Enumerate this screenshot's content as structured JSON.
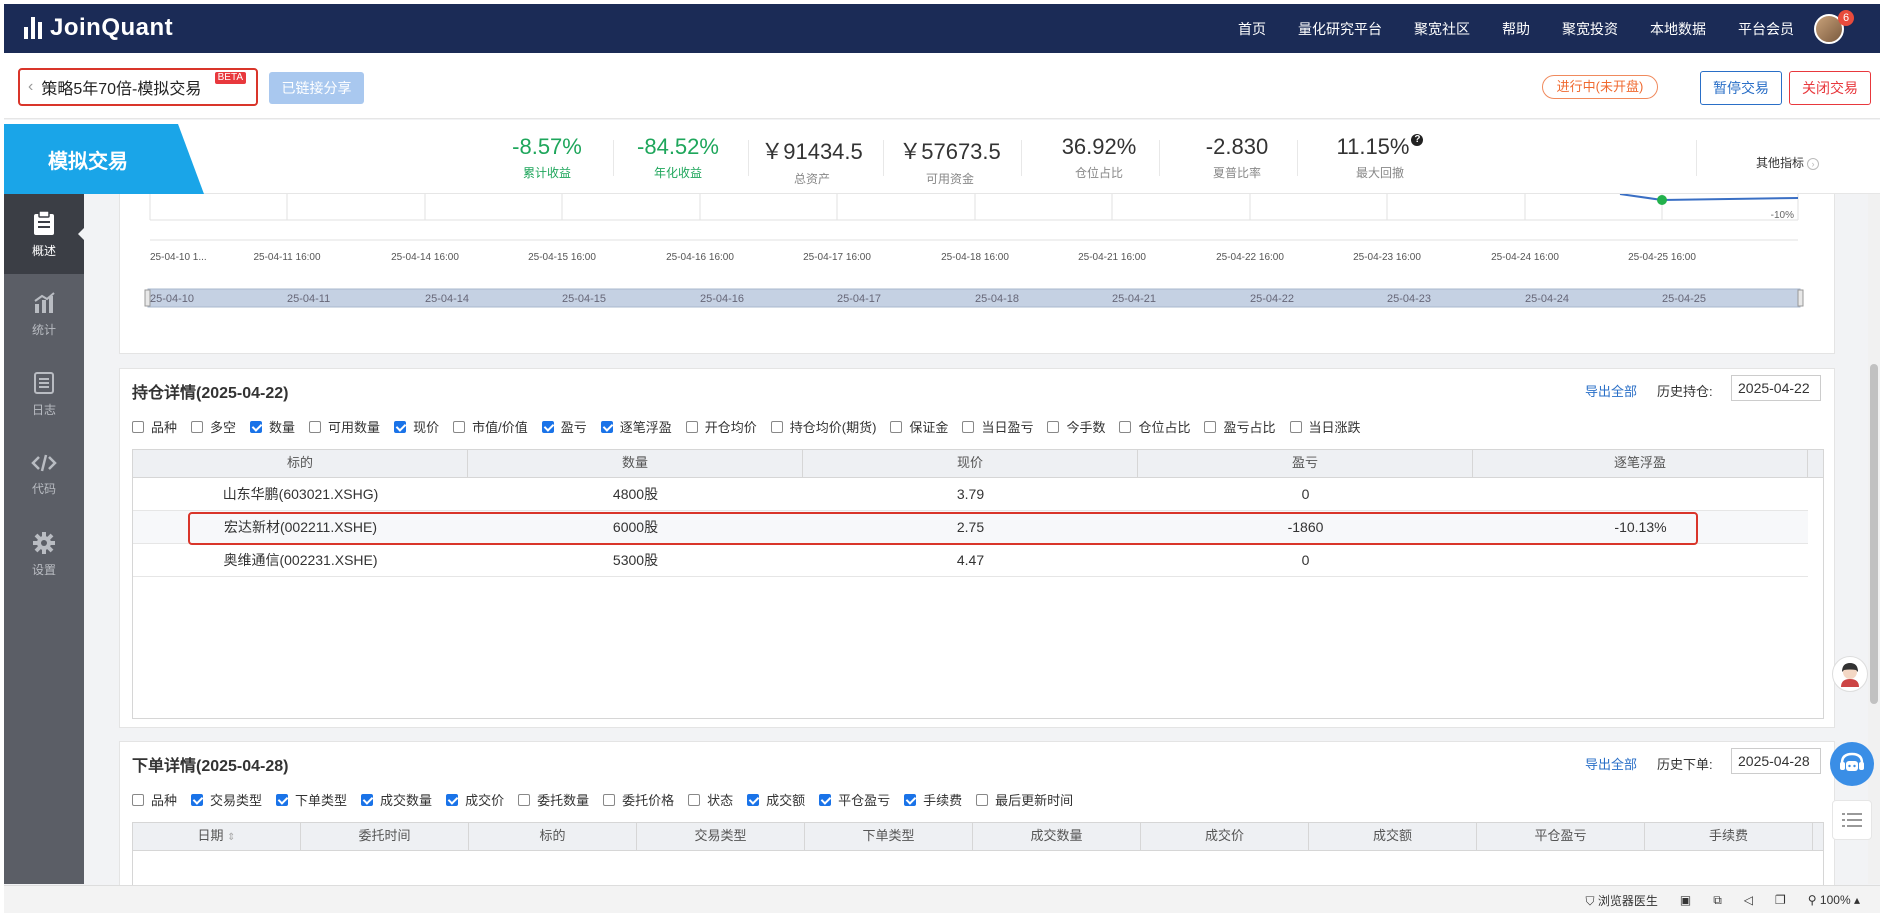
{
  "app": {
    "logo_text": "JoinQuant"
  },
  "nav": {
    "links": [
      "首页",
      "量化研究平台",
      "聚宽社区",
      "帮助",
      "聚宽投资",
      "本地数据",
      "平台会员"
    ],
    "avatar_badge": "6"
  },
  "title_bar": {
    "strategy_name": "策略5年70倍-模拟交易",
    "beta_label": "BETA",
    "share_button": "已链接分享",
    "status": "进行中(未开盘)",
    "pause_button": "暂停交易",
    "close_button": "关闭交易"
  },
  "metrics_bar": {
    "mode_label": "模拟交易",
    "metrics": [
      {
        "value": "-8.57%",
        "label": "累计收益",
        "color": "#1ea65b"
      },
      {
        "value": "-84.52%",
        "label": "年化收益",
        "color": "#1ea65b"
      },
      {
        "value": "￥91434.5",
        "label": "总资产"
      },
      {
        "value": "￥57673.5",
        "label": "可用资金"
      },
      {
        "value": "36.92%",
        "label": "仓位占比"
      },
      {
        "value": "-2.830",
        "label": "夏普比率"
      },
      {
        "value": "11.15%",
        "label": "最大回撤"
      }
    ],
    "other_metrics": "其他指标"
  },
  "sidebar": {
    "items": [
      {
        "label": "概述",
        "icon": "clipboard-icon",
        "active": true
      },
      {
        "label": "统计",
        "icon": "stats-icon"
      },
      {
        "label": "日志",
        "icon": "log-icon"
      },
      {
        "label": "代码",
        "icon": "code-icon"
      },
      {
        "label": "设置",
        "icon": "gear-icon"
      }
    ]
  },
  "chart": {
    "y_label": "-10%",
    "x_ticks": [
      "25-04-10 1...",
      "25-04-11 16:00",
      "25-04-14 16:00",
      "25-04-15 16:00",
      "25-04-16 16:00",
      "25-04-17 16:00",
      "25-04-18 16:00",
      "25-04-21 16:00",
      "25-04-22 16:00",
      "25-04-23 16:00",
      "25-04-24 16:00",
      "25-04-25 16:00"
    ],
    "range_ticks": [
      "25-04-10",
      "25-04-11",
      "25-04-14",
      "25-04-15",
      "25-04-16",
      "25-04-17",
      "25-04-18",
      "25-04-21",
      "25-04-22",
      "25-04-23",
      "25-04-24",
      "25-04-25"
    ]
  },
  "positions": {
    "title": "持仓详情(2025-04-22)",
    "export_label": "导出全部",
    "history_label": "历史持仓:",
    "date_value": "2025-04-22",
    "checkboxes": [
      {
        "label": "品种",
        "checked": false
      },
      {
        "label": "多空",
        "checked": false
      },
      {
        "label": "数量",
        "checked": true
      },
      {
        "label": "可用数量",
        "checked": false
      },
      {
        "label": "现价",
        "checked": true
      },
      {
        "label": "市值/价值",
        "checked": false
      },
      {
        "label": "盈亏",
        "checked": true
      },
      {
        "label": "逐笔浮盈",
        "checked": true
      },
      {
        "label": "开仓均价",
        "checked": false
      },
      {
        "label": "持仓均价(期货)",
        "checked": false
      },
      {
        "label": "保证金",
        "checked": false
      },
      {
        "label": "当日盈亏",
        "checked": false
      },
      {
        "label": "今手数",
        "checked": false
      },
      {
        "label": "仓位占比",
        "checked": false
      },
      {
        "label": "盈亏占比",
        "checked": false
      },
      {
        "label": "当日涨跌",
        "checked": false
      }
    ],
    "columns": [
      "标的",
      "数量",
      "现价",
      "盈亏",
      "逐笔浮盈"
    ],
    "rows": [
      [
        "山东华鹏(603021.XSHG)",
        "4800股",
        "3.79",
        "0",
        ""
      ],
      [
        "宏达新材(002211.XSHE)",
        "6000股",
        "2.75",
        "-1860",
        "-10.13%"
      ],
      [
        "奥维通信(002231.XSHE)",
        "5300股",
        "4.47",
        "0",
        ""
      ]
    ]
  },
  "orders": {
    "title": "下单详情(2025-04-28)",
    "export_label": "导出全部",
    "history_label": "历史下单:",
    "date_value": "2025-04-28",
    "checkboxes": [
      {
        "label": "品种",
        "checked": false
      },
      {
        "label": "交易类型",
        "checked": true
      },
      {
        "label": "下单类型",
        "checked": true
      },
      {
        "label": "成交数量",
        "checked": true
      },
      {
        "label": "成交价",
        "checked": true
      },
      {
        "label": "委托数量",
        "checked": false
      },
      {
        "label": "委托价格",
        "checked": false
      },
      {
        "label": "状态",
        "checked": false
      },
      {
        "label": "成交额",
        "checked": true
      },
      {
        "label": "平仓盈亏",
        "checked": true
      },
      {
        "label": "手续费",
        "checked": true
      },
      {
        "label": "最后更新时间",
        "checked": false
      }
    ],
    "columns": [
      "日期",
      "委托时间",
      "标的",
      "交易类型",
      "下单类型",
      "成交数量",
      "成交价",
      "成交额",
      "平仓盈亏",
      "手续费"
    ]
  },
  "status_bar": {
    "items": [
      "浏览器医生",
      "100%"
    ]
  }
}
